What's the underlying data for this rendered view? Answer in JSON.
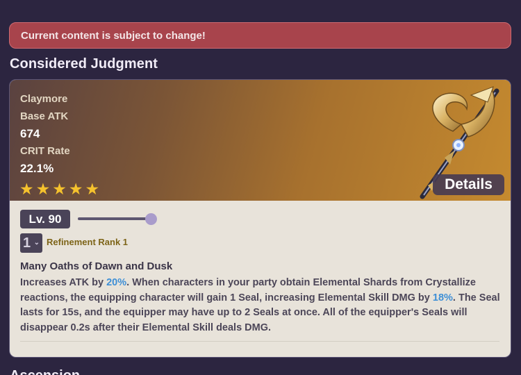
{
  "alert": {
    "text": "Current content is subject to change!"
  },
  "weapon": {
    "name": "Considered Judgment",
    "type": "Claymore",
    "base_atk_label": "Base ATK",
    "base_atk": "674",
    "sub_stat_label": "CRIT Rate",
    "sub_stat": "22.1%",
    "stars": 5,
    "details_label": "Details",
    "level_label": "Lv. 90",
    "level_slider_fraction": 1.0,
    "refinement_value": "1",
    "refinement_label": "Refinement Rank 1",
    "passive_name": "Many Oaths of Dawn and Dusk",
    "passive_parts": {
      "p1": "Increases ATK by ",
      "h1": "20%",
      "p2": ". When characters in your party obtain Elemental Shards from Crystallize reactions, the equipping character will gain 1 Seal, increasing Elemental Skill DMG by ",
      "h2": "18%",
      "p3": ". The Seal lasts for 15s, and the equipper may have up to 2 Seals at once. All of the equipper's Seals will disappear 0.2s after their Elemental Skill deals DMG."
    }
  },
  "next_section": {
    "heading": "Ascension"
  },
  "colors": {
    "accent": "#3e8fd6",
    "alert_bg": "#a8444c",
    "star": "#f5c22d"
  }
}
